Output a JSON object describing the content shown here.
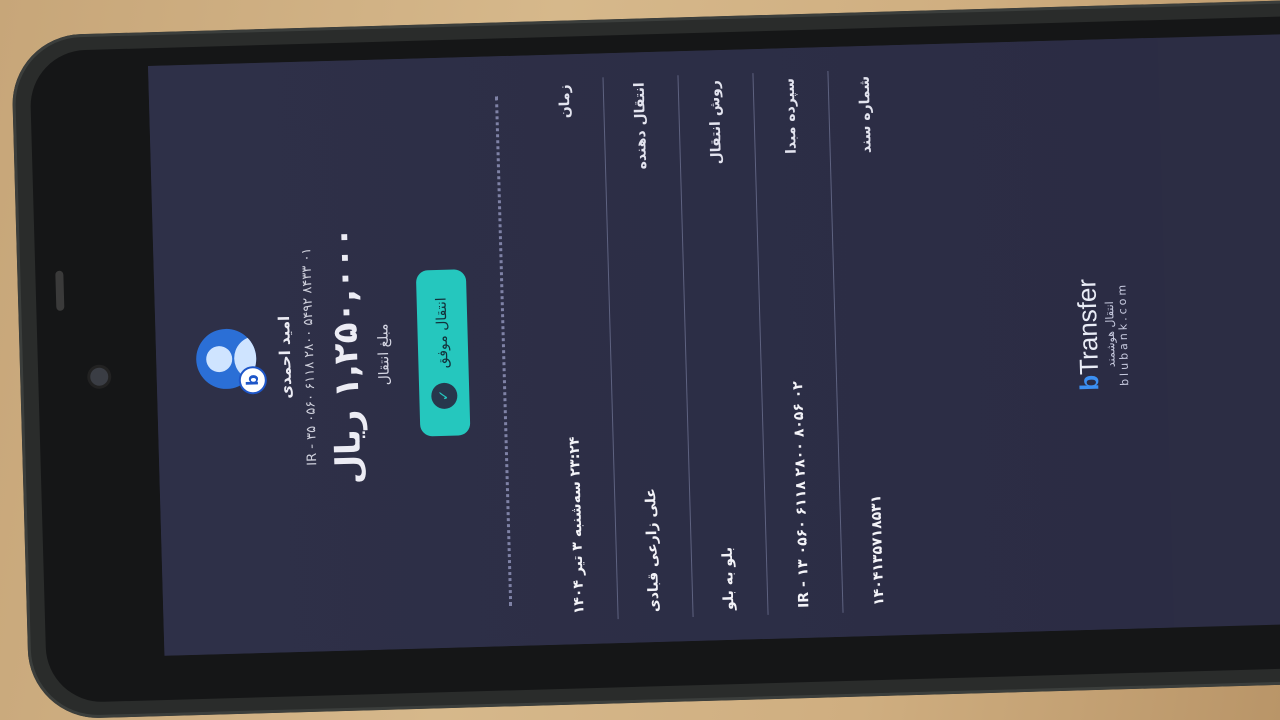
{
  "receipt": {
    "sender_name": "امید احمدی",
    "sender_iban": "IR - ۳۵ ۰۵۶۰ ۶۱۱۸ ۲۸۰۰ ۵۴۹۲ ۸۴۳۳ ۰۱",
    "amount": "۱,۲۵۰,۰۰۰ ریال",
    "amount_label": "مبلغ انتقال",
    "status": "انتقال موفق",
    "rows": [
      {
        "label": "زمان",
        "value": "۲۳:۲۴ سه‌شنبه ۳ تیر ۱۴۰۴"
      },
      {
        "label": "انتقال دهنده",
        "value": "علی زارعی قبادی"
      },
      {
        "label": "روش انتقال",
        "value": "بلو به بلو"
      },
      {
        "label": "سپرده مبدا",
        "value": "IR - ۱۳ ۰۵۶۰ ۶۱۱۸ ۲۸۰۰ ۸۰۵۶ ۰۲"
      },
      {
        "label": "شماره سند",
        "value": "۱۴۰۴۱۳۵۷۱۸۵۳۱"
      }
    ]
  },
  "brand": {
    "logo_letter": "b",
    "logo_text": "Transfer",
    "subtitle": "انتقال هوشمند",
    "site": "blubank.com"
  },
  "colors": {
    "screen_bg": "#2c2d44",
    "accent": "#25c7be",
    "brand_blue": "#3b8ff2"
  },
  "icons": [
    "user-avatar-icon",
    "blu-badge-icon",
    "check-icon"
  ]
}
